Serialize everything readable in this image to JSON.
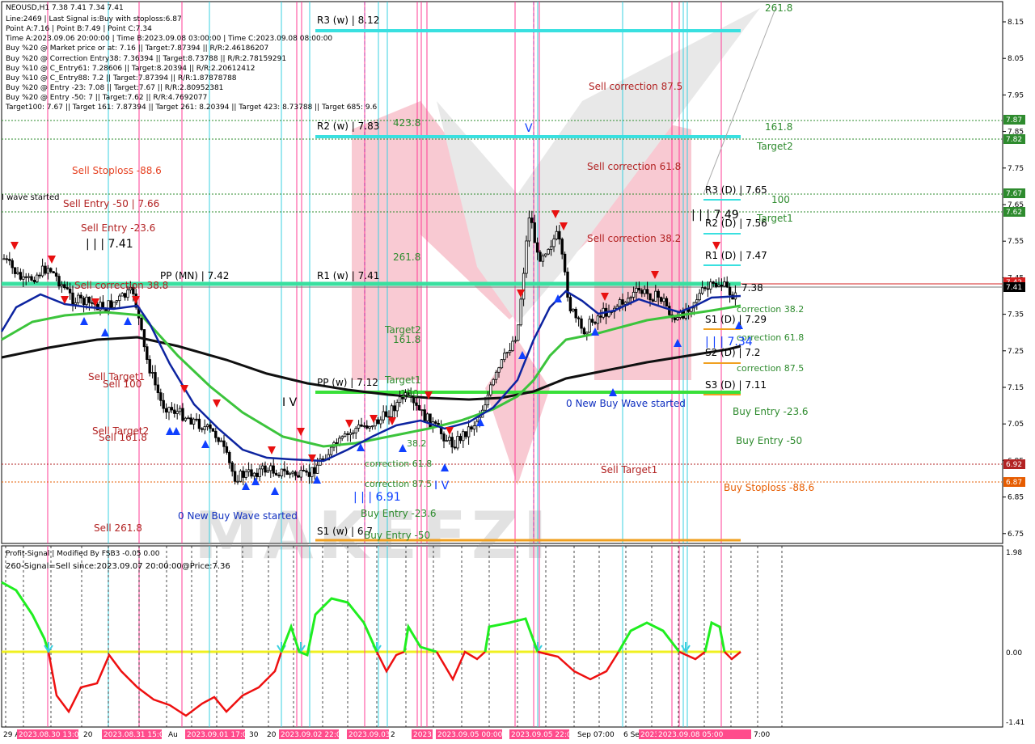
{
  "header": {
    "lines": [
      "NEOUSD,H1  7.38 7.41 7.34 7.41",
      "Line:2469 | Last Signal is:Buy with stoploss:6.87",
      "Point A:7.16 | Point B:7.49 | Point C:7.34",
      "Time A:2023.09.06 20:00:00 | Time B:2023.09.08 03:00:00 | Time C:2023.09.08 08:00:00",
      "Buy %20 @ Market price or at: 7.16 || Target:7.87394 || R/R:2.46186207",
      "Buy %20 @ Correction Entry38: 7.36394 || Target:8.73788 || R/R:2.78159291",
      "Buy %10 @ C_Entry61: 7.28606 || Target:8.20394 || R/R:2.20612412",
      "Buy %10 @ C_Entry88: 7.2 || Target:7.87394 || R/R:1.87878788",
      "Buy %20 @ Entry -23: 7.08 || Target:7.67 || R/R:2.80952381",
      "Buy %20 @ Entry -50: 7 || Target:7.62 || R/R:4.7692077",
      "Target100: 7.67 || Target 161: 7.87394 || Target 261: 8.20394 || Target 423: 8.73788 || Target 685: 9.6"
    ]
  },
  "price_axis": {
    "ticks": [
      "8.15",
      "8.05",
      "7.95",
      "7.85",
      "7.75",
      "7.65",
      "7.55",
      "7.45",
      "7.35",
      "7.25",
      "7.15",
      "7.05",
      "6.95",
      "6.85",
      "6.75"
    ],
    "badges": [
      {
        "label": "7.87",
        "color": "#2e8b2e"
      },
      {
        "label": "7.82",
        "color": "#2e8b2e"
      },
      {
        "label": "7.67",
        "color": "#2e8b2e"
      },
      {
        "label": "7.62",
        "color": "#2e8b2e"
      },
      {
        "label": "7.42",
        "color": "#d42020"
      },
      {
        "label": "7.41",
        "color": "#000000"
      },
      {
        "label": "6.92",
        "color": "#b22222"
      },
      {
        "label": "6.87",
        "color": "#e65c00"
      }
    ]
  },
  "levels": {
    "r3w": "R3 (w) | 8.12",
    "r2w": "R2 (w) | 7.83",
    "r1w": "R1 (w) | 7.41",
    "ppw": "PP (w) | 7.12",
    "s1w": "S1 (w) | 6.7",
    "ppmn": "PP (MN) | 7.42",
    "r3d": "R3 (D) | 7.65",
    "r2d": "R2 (D) | 7.56",
    "r1d": "R1 (D) | 7.47",
    "s1d": "S1 (D) | 7.29",
    "s2d": "S2 (D) | 7.2",
    "s3d": "S3 (D) | 7.11",
    "pp_d_val": "7.38"
  },
  "annotations": {
    "fib_261_top": "261.8",
    "fib_161_right": "161.8",
    "target2_right": "Target2",
    "fib_100_right": "100",
    "target1_right": "Target1",
    "corr_382_r": "correction 38.2",
    "corr_618_r": "correction 61.8",
    "corr_875_r": "correction 87.5",
    "buy_entry_236_r": "Buy Entry -23.6",
    "buy_entry_50_r": "Buy Entry -50",
    "sell_target1_r": "Sell Target1",
    "buy_stoploss_r": "Buy Stoploss -88.6",
    "sell_corr_875": "Sell correction 87.5",
    "sell_corr_618": "Sell correction 61.8",
    "sell_corr_382": "Sell correction 38.2",
    "wave_label_right": "| | | 7.49",
    "wave_label_right2": "| | | 7.34",
    "wave_v_top": "V",
    "fib_423_mid": "423.8",
    "fib_261_mid": "261.8",
    "target2_mid": "Target2",
    "fib_161_mid": "161.8",
    "target1_mid": "Target1",
    "fib_100_mid": "100",
    "new_buy_wave_mid": "0 New Buy Wave started",
    "wave_iv": "I V",
    "wave_iv2": "I V",
    "corr_382_mid": "38.2",
    "corr_618_mid": "correction 61.8",
    "corr_875_mid": "correction 87.5",
    "wave_691": "| | | 6.91",
    "buy_entry_236_mid": "Buy Entry -23.6",
    "buy_entry_50_mid": "Buy Entry -50",
    "sell_stoploss_left": "Sell Stoploss -88.6",
    "wave_started_left": "I wave started",
    "sell_entry_50_left": "Sell Entry -50 | 7.66",
    "sell_entry_236_left": "Sell Entry -23.6",
    "wave_741_left": "| | | 7.41",
    "sell_corr_left": "Sell correction 38.8",
    "sell_target1_left": "Sell Target1",
    "sell_100_left": "Sell 100",
    "sell_target2_left": "Sell Target2",
    "sell_161_left": "Sell 161.8",
    "new_buy_wave_left": "0 New Buy Wave started",
    "sell_261_left": "Sell   261.8"
  },
  "indicator": {
    "title": "Profit-Signal | Modified By FSB3 -0.05 0.00",
    "signal": "260-Signal=Sell since:2023.09.07 20:00:00@Price:7.36",
    "ticks": [
      "1.98",
      "0.00",
      "-1.41"
    ]
  },
  "time_axis": [
    {
      "label": "29 A",
      "hl": false
    },
    {
      "label": "2023.08.30 13:00",
      "hl": true
    },
    {
      "label": "20",
      "hl": false
    },
    {
      "label": "2023.08.31 15:00",
      "hl": true
    },
    {
      "label": "Au",
      "hl": false
    },
    {
      "label": "2023.09.01 17:00",
      "hl": true
    },
    {
      "label": "30",
      "hl": false
    },
    {
      "label": "20",
      "hl": false
    },
    {
      "label": "2023.09.02 22:00",
      "hl": true
    },
    {
      "label": "2023.09.03",
      "hl": true
    },
    {
      "label": "2",
      "hl": false
    },
    {
      "label": "2023.09.04",
      "hl": true
    },
    {
      "label": "2023.09.05 00:00",
      "hl": true
    },
    {
      "label": "2023.09.05 22:00",
      "hl": true
    },
    {
      "label": "Sep 07:00",
      "hl": false
    },
    {
      "label": "6 Se",
      "hl": false
    },
    {
      "label": "2023.09.",
      "hl": true
    },
    {
      "label": "2023.09.08 05:00",
      "hl": true
    },
    {
      "label": "7:00",
      "hl": false
    }
  ],
  "colors": {
    "cyan_level": "#39e0e0",
    "green_level": "#39e039",
    "daily_orange": "#f0a020",
    "daily_cyan": "#39e0e0",
    "ma_blue": "#0d24a0",
    "ma_green": "#3cc43c",
    "ma_black": "#101010",
    "sell_red": "#e81010",
    "buy_blue": "#1040ff",
    "vline_pink": "#ff3c96",
    "vline_cyan": "#39d0e0"
  }
}
